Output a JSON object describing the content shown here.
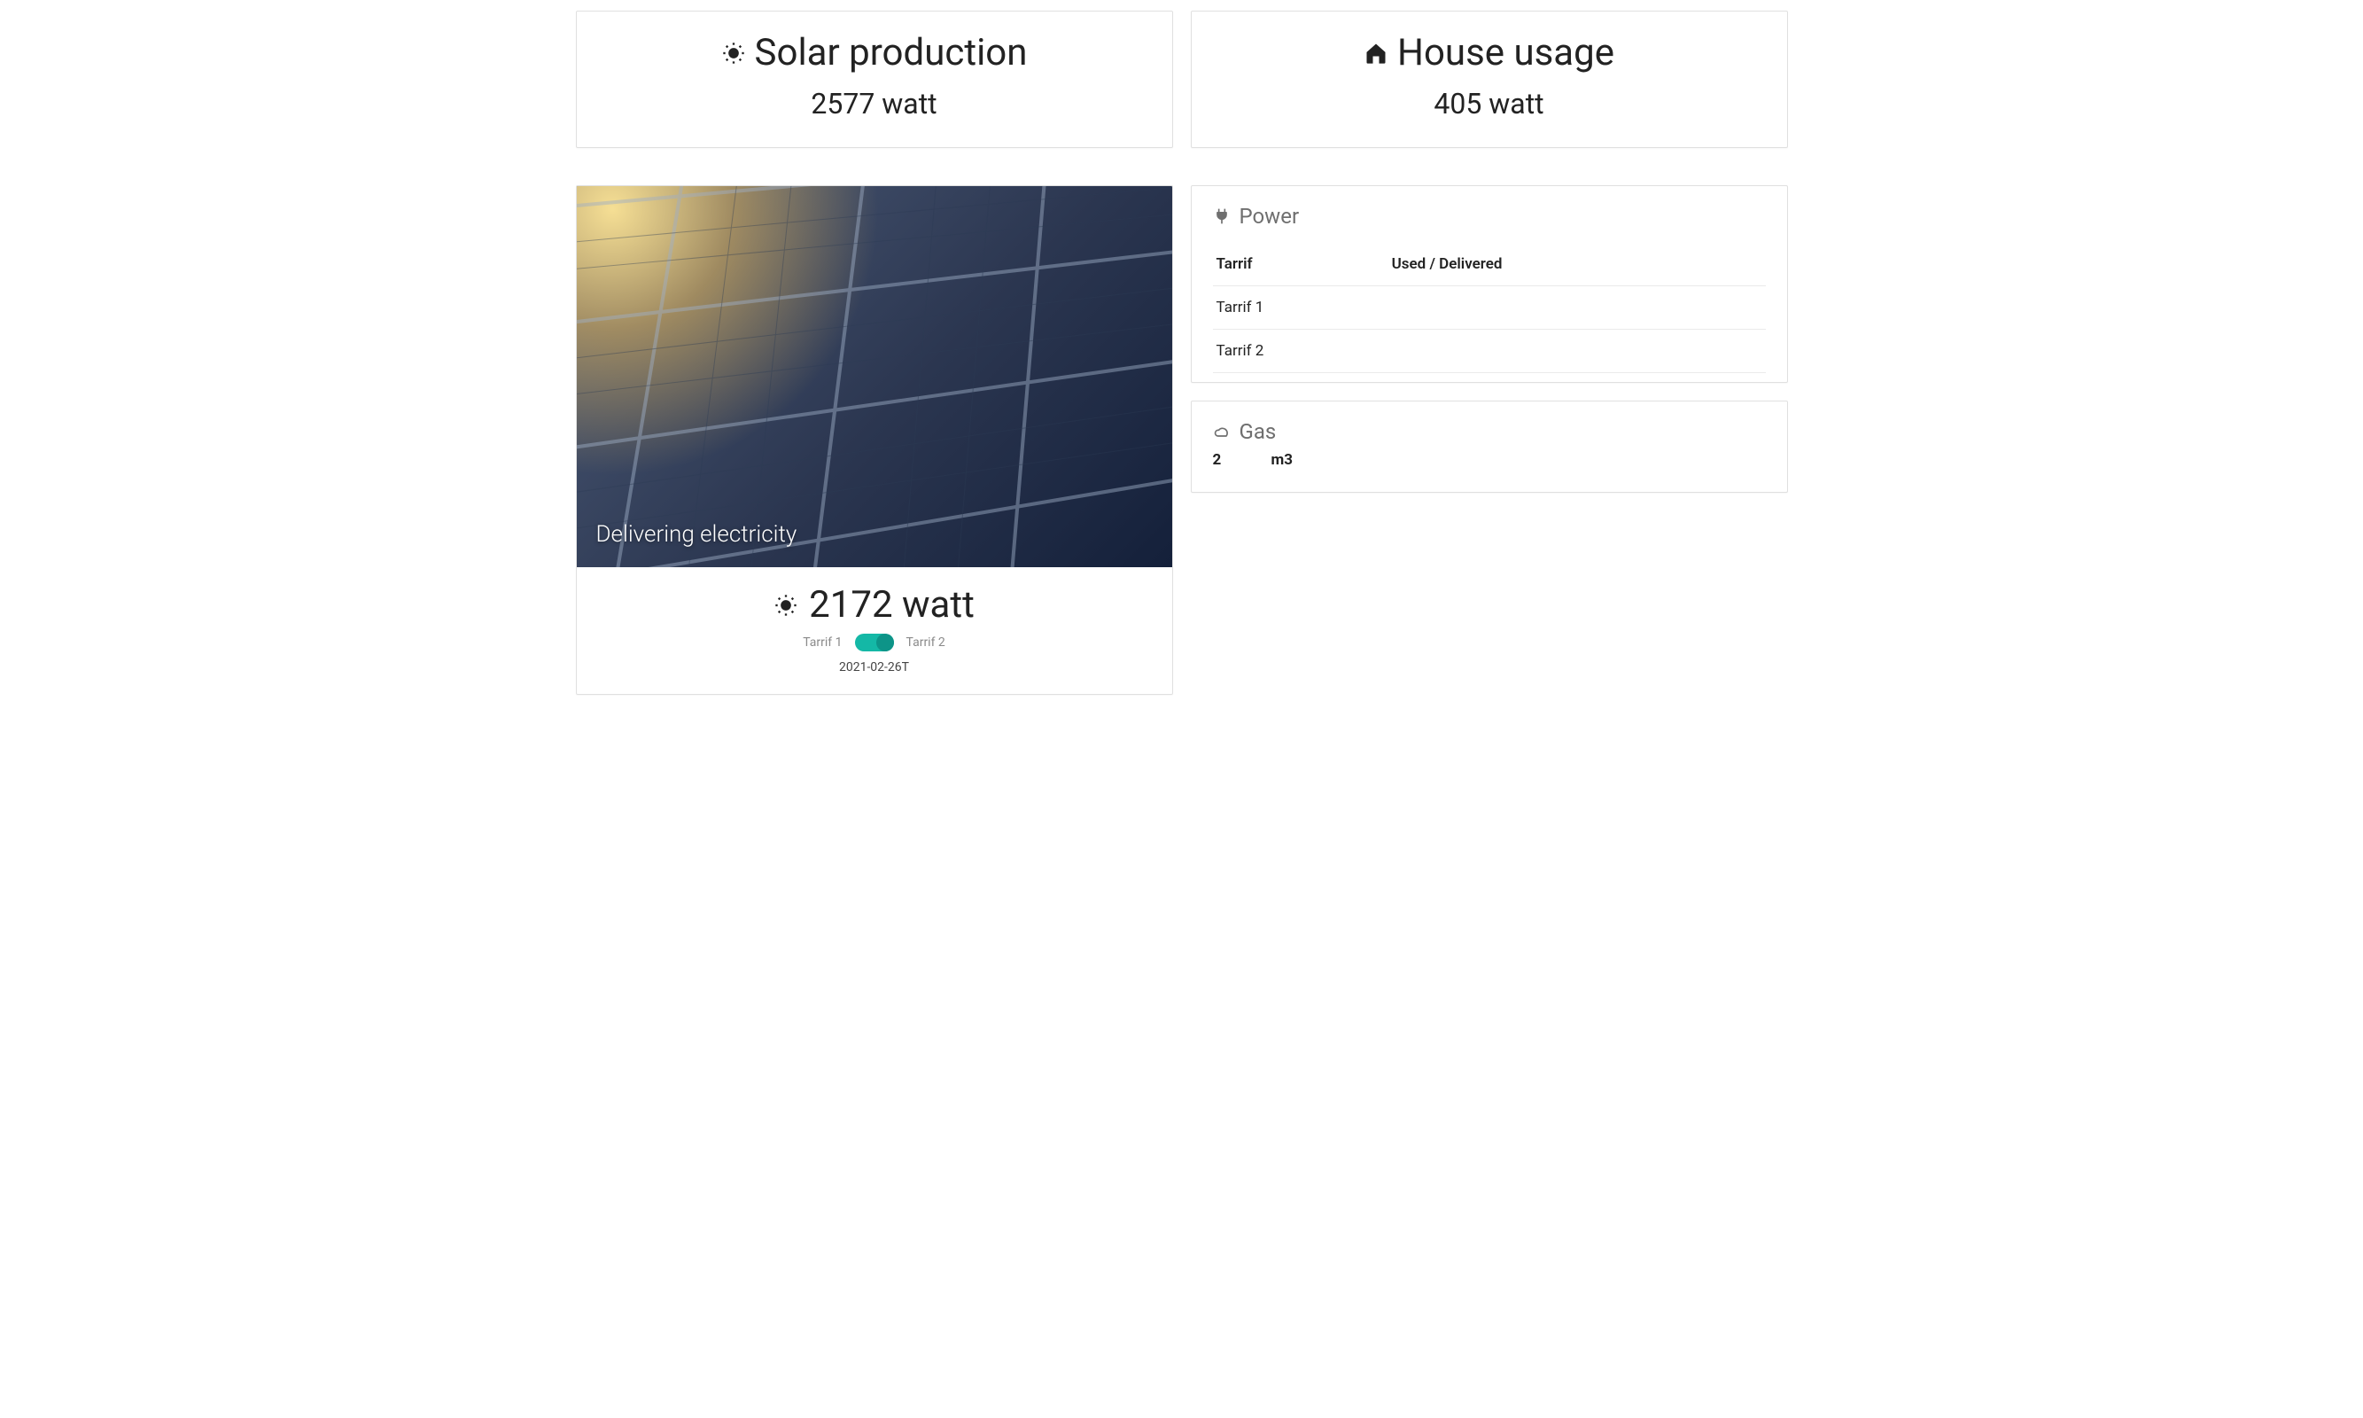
{
  "top": {
    "solar": {
      "label": "Solar production",
      "value": "2577 watt"
    },
    "house": {
      "label": "House usage",
      "value": "405 watt"
    }
  },
  "delivering": {
    "caption": "Delivering electricity",
    "value": "2172 watt",
    "tarrif_left": "Tarrif 1",
    "tarrif_right": "Tarrif 2",
    "timestamp": "2021-02-26T"
  },
  "power": {
    "title": "Power",
    "cols": {
      "c1": "Tarrif",
      "c2": "Used / Delivered"
    },
    "rows": [
      {
        "name": "Tarrif 1",
        "value": ""
      },
      {
        "name": "Tarrif 2",
        "value": ""
      }
    ]
  },
  "gas": {
    "title": "Gas",
    "unit": "m3"
  }
}
